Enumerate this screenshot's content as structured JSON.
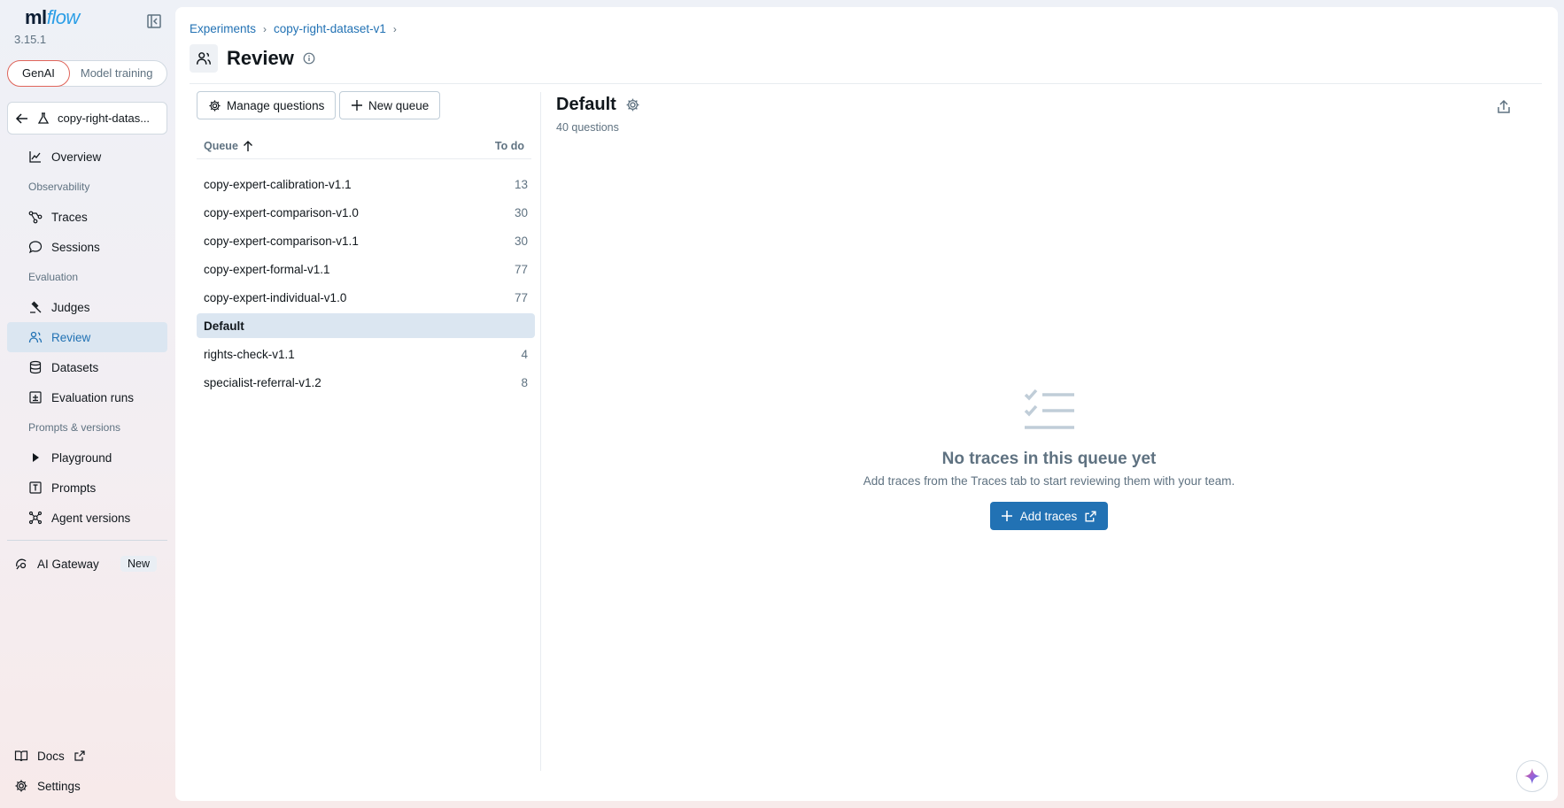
{
  "app": {
    "logo_text": "mlflow",
    "version": "3.15.1"
  },
  "sidebar": {
    "mode_tabs": [
      {
        "label": "GenAI"
      },
      {
        "label": "Model training"
      }
    ],
    "experiment_name": "copy-right-datas...",
    "items": {
      "overview": "Overview",
      "observability": "Observability",
      "traces": "Traces",
      "sessions": "Sessions",
      "evaluation": "Evaluation",
      "judges": "Judges",
      "review": "Review",
      "datasets": "Datasets",
      "evaluation_runs": "Evaluation runs",
      "prompts_versions": "Prompts & versions",
      "playground": "Playground",
      "prompts": "Prompts",
      "agent_versions": "Agent versions"
    },
    "gateway": {
      "label": "AI Gateway",
      "badge": "New"
    },
    "docs": "Docs",
    "settings": "Settings"
  },
  "breadcrumb": [
    "Experiments",
    "copy-right-dataset-v1"
  ],
  "page": {
    "title": "Review"
  },
  "toolbar": {
    "manage_questions": "Manage questions",
    "new_queue": "New queue"
  },
  "queue_table": {
    "col_queue": "Queue",
    "col_todo": "To do",
    "rows": [
      {
        "name": "copy-expert-calibration-v1.1",
        "todo": "13"
      },
      {
        "name": "copy-expert-comparison-v1.0",
        "todo": "30"
      },
      {
        "name": "copy-expert-comparison-v1.1",
        "todo": "30"
      },
      {
        "name": "copy-expert-formal-v1.1",
        "todo": "77"
      },
      {
        "name": "copy-expert-individual-v1.0",
        "todo": "77"
      },
      {
        "name": "Default",
        "todo": ""
      },
      {
        "name": "rights-check-v1.1",
        "todo": "4"
      },
      {
        "name": "specialist-referral-v1.2",
        "todo": "8"
      }
    ],
    "selected": "Default"
  },
  "detail": {
    "title": "Default",
    "subtitle": "40 questions",
    "empty_title": "No traces in this queue yet",
    "empty_text": "Add traces from the Traces tab to start reviewing them with your team.",
    "add_traces": "Add traces"
  },
  "colors": {
    "accent": "#2272b4",
    "active_bg": "#dbe6f1",
    "genai_border": "#e0655b"
  }
}
